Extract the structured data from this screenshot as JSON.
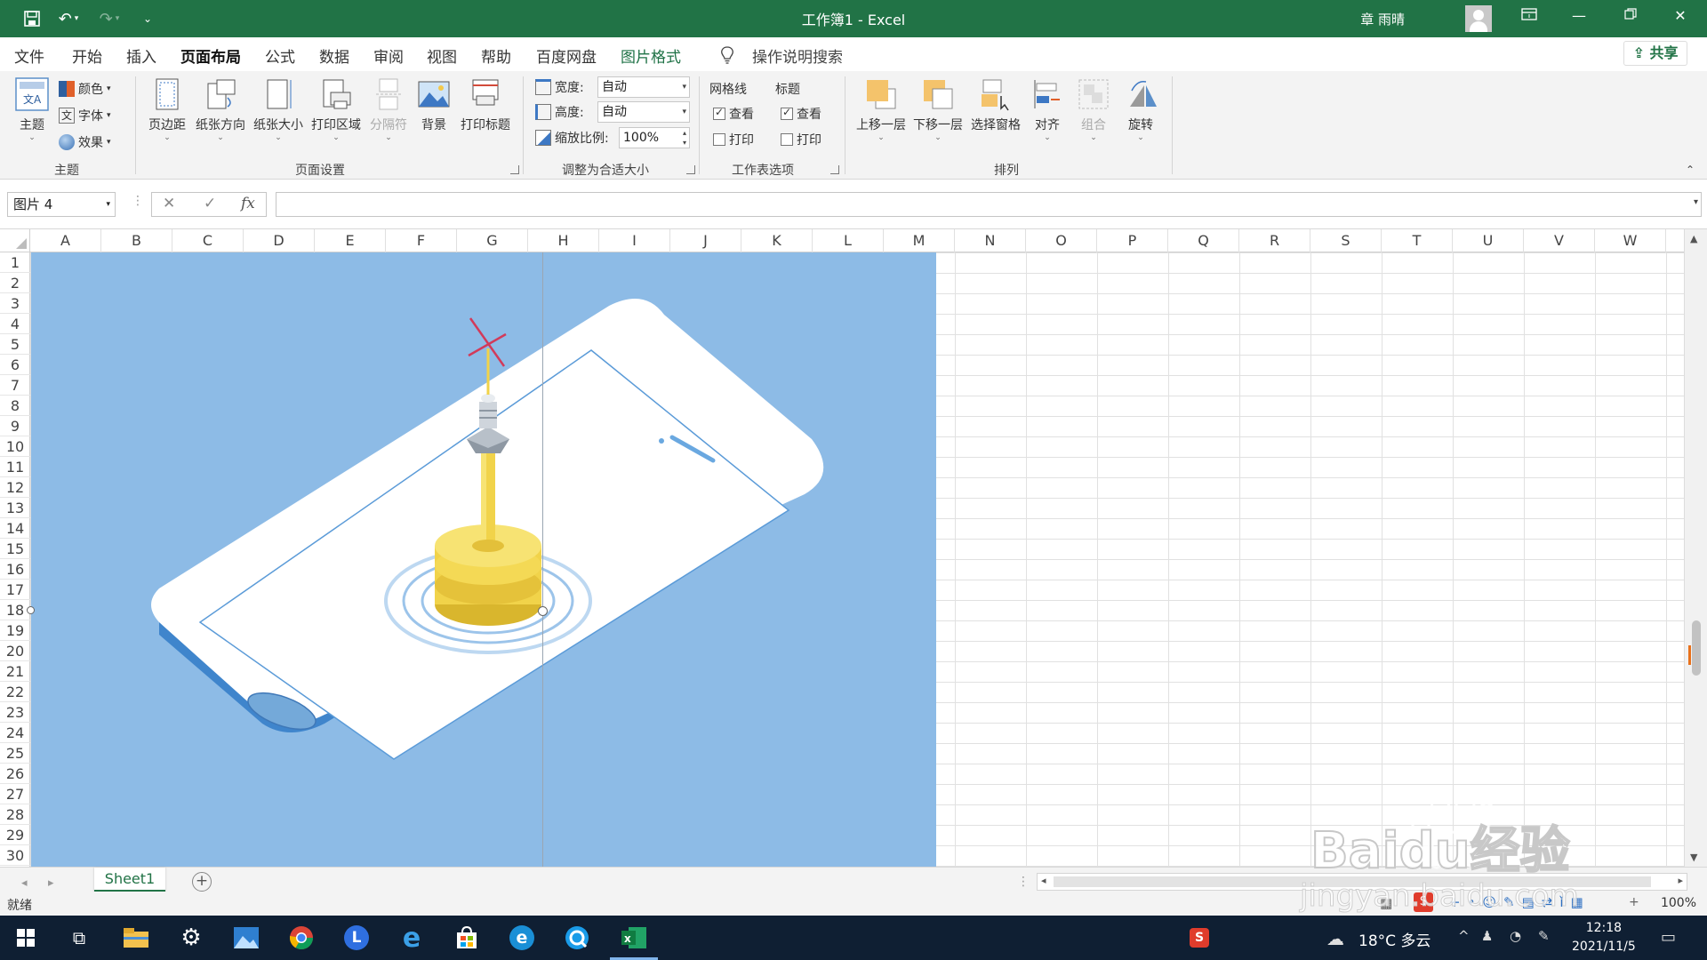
{
  "titlebar": {
    "title": "工作簿1  -  Excel",
    "user": "章 雨晴",
    "colors": {
      "bg": "#217346"
    }
  },
  "tabs": [
    {
      "label": "文件"
    },
    {
      "label": "开始"
    },
    {
      "label": "插入"
    },
    {
      "label": "页面布局"
    },
    {
      "label": "公式"
    },
    {
      "label": "数据"
    },
    {
      "label": "审阅"
    },
    {
      "label": "视图"
    },
    {
      "label": "帮助"
    },
    {
      "label": "百度网盘"
    },
    {
      "label": "图片格式"
    }
  ],
  "search": {
    "label": "操作说明搜索"
  },
  "share": {
    "label": "共享"
  },
  "ribbon": {
    "theme": {
      "main": "主题",
      "colors": "颜色",
      "fonts": "字体",
      "effects": "效果",
      "group": "主题"
    },
    "page_setup": {
      "margins": "页边距",
      "orientation": "纸张方向",
      "size": "纸张大小",
      "print_area": "打印区域",
      "breaks": "分隔符",
      "background": "背景",
      "print_titles": "打印标题",
      "group": "页面设置"
    },
    "scale": {
      "width_label": "宽度:",
      "width_value": "自动",
      "height_label": "高度:",
      "height_value": "自动",
      "scale_label": "缩放比例:",
      "scale_value": "100%",
      "group": "调整为合适大小"
    },
    "sheet_options": {
      "gridlines": "网格线",
      "headings": "标题",
      "view": "查看",
      "print": "打印",
      "group": "工作表选项"
    },
    "arrange": {
      "bring_forward": "上移一层",
      "send_backward": "下移一层",
      "selection_pane": "选择窗格",
      "align": "对齐",
      "group_btn": "组合",
      "rotate": "旋转",
      "group": "排列"
    }
  },
  "formula": {
    "namebox": "图片 4",
    "fx": "fx",
    "value": ""
  },
  "columns": [
    "A",
    "B",
    "C",
    "D",
    "E",
    "F",
    "G",
    "H",
    "I",
    "J",
    "K",
    "L",
    "M",
    "N",
    "O",
    "P",
    "Q",
    "R",
    "S",
    "T",
    "U",
    "V",
    "W"
  ],
  "rows": [
    "1",
    "2",
    "3",
    "4",
    "5",
    "6",
    "7",
    "8",
    "9",
    "10",
    "11",
    "12",
    "13",
    "14",
    "15",
    "16",
    "17",
    "18",
    "19",
    "20",
    "21",
    "22",
    "23",
    "24",
    "25",
    "26",
    "27",
    "28",
    "29",
    "30"
  ],
  "sheets": {
    "active": "Sheet1"
  },
  "status": {
    "ready": "就绪",
    "zoom": "100%"
  },
  "taskbar": {
    "weather": "18°C  多云",
    "time": "12:18",
    "date": "2021/11/5"
  },
  "watermark": {
    "text": "Baidu经验",
    "sub": "jingyan.baidu.com"
  }
}
